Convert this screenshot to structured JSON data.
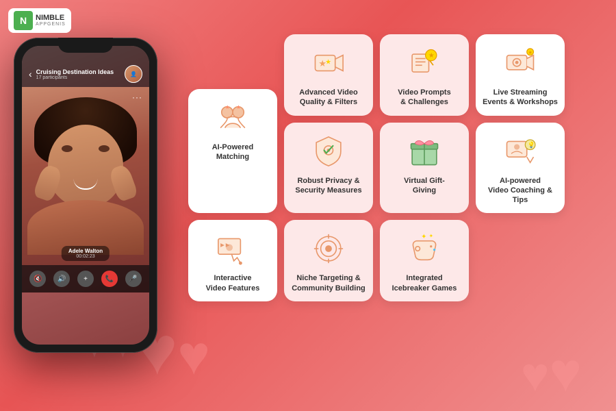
{
  "logo": {
    "icon_text": "N",
    "nimble": "NIMBLE",
    "appgenis": "APPGENIS"
  },
  "phone": {
    "chat_title": "Cruising Destination Ideas",
    "participants": "17 participants",
    "person_name": "Adele Walton",
    "timer": "00:02:23",
    "controls": [
      "🔇",
      "🔊",
      "+",
      "📞",
      "🎤"
    ]
  },
  "cards": [
    {
      "id": "ai-matching",
      "label": "AI-Powered Matching",
      "icon_type": "people"
    },
    {
      "id": "adv-video",
      "label": "Advanced Video Quality & Filters",
      "icon_type": "star-phone"
    },
    {
      "id": "robust",
      "label": "Robust Privacy & Security Measures",
      "icon_type": "shield"
    },
    {
      "id": "niche",
      "label": "Niche Targeting & Community Building",
      "icon_type": "target"
    },
    {
      "id": "interactive",
      "label": "Interactive Video Features",
      "icon_type": "video-star"
    },
    {
      "id": "video-prompts",
      "label": "Video Prompts & Challenges",
      "icon_type": "film-star"
    },
    {
      "id": "virtual-gift",
      "label": "Virtual Gift-Giving",
      "icon_type": "gift"
    },
    {
      "id": "icebreaker",
      "label": "Integrated Icebreaker Games",
      "icon_type": "game"
    },
    {
      "id": "live-stream",
      "label": "Live Streaming Events & Workshops",
      "icon_type": "camera-star"
    },
    {
      "id": "ai-coaching",
      "label": "AI-powered Video Coaching & Tips",
      "icon_type": "coaching"
    }
  ]
}
